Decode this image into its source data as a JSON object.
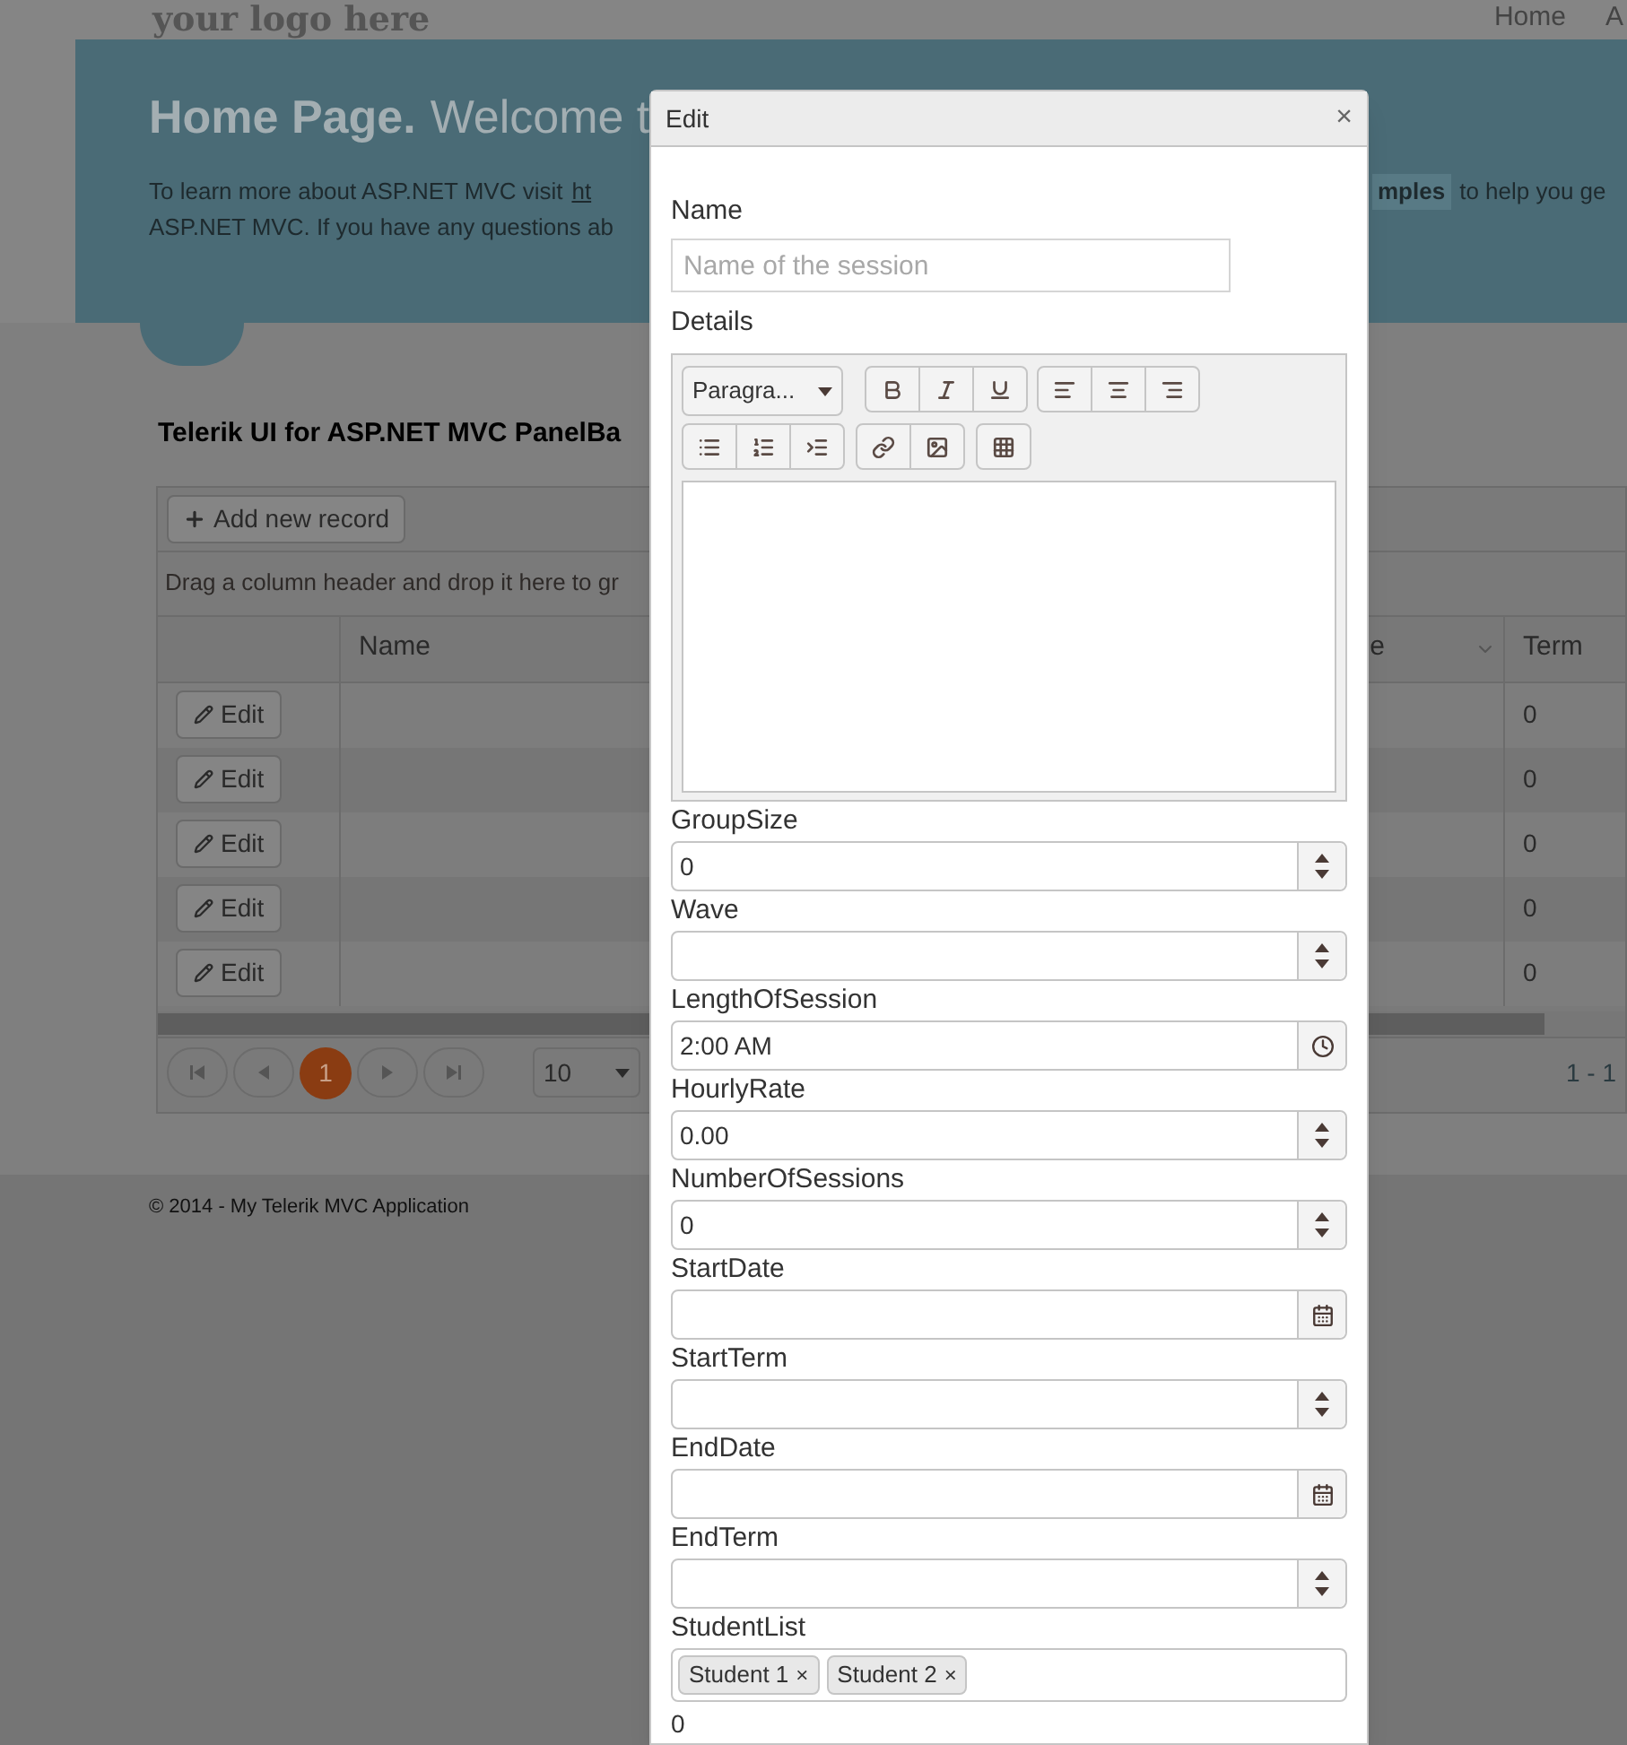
{
  "header": {
    "logo": "your logo here",
    "nav": [
      {
        "label": "Home"
      },
      {
        "label": "A"
      }
    ]
  },
  "jumbotron": {
    "title": "Home Page.",
    "subtitle": "Welcome t",
    "line1_left": "To learn more about ASP.NET MVC visit",
    "line1_link": "ht",
    "line1_highlight": "mples",
    "line1_right": "to help you ge",
    "line2": "ASP.NET MVC. If you have any questions ab"
  },
  "section_title": "Telerik UI for ASP.NET MVC PanelBa",
  "grid": {
    "toolbar_button": "Add new record",
    "group_hint": "Drag a column header and drop it here to gr",
    "columns": [
      {
        "label": "Name"
      },
      {
        "label": "e"
      },
      {
        "label": "Term"
      }
    ],
    "rows": [
      {
        "action": "Edit",
        "term": "0"
      },
      {
        "action": "Edit",
        "term": "0"
      },
      {
        "action": "Edit",
        "term": "0"
      },
      {
        "action": "Edit",
        "term": "0"
      },
      {
        "action": "Edit",
        "term": "0"
      }
    ],
    "pager": {
      "pages": [
        {
          "label": "1",
          "selected": true
        }
      ],
      "page_size": "10",
      "info": "1 - 1"
    }
  },
  "footer": "© 2014 - My Telerik MVC Application",
  "dialog": {
    "title": "Edit",
    "close": "×",
    "name_label": "Name",
    "name_placeholder": "Name of the session",
    "details_label": "Details",
    "format": "Paragra...",
    "fields": [
      {
        "label": "GroupSize",
        "kind": "numeric",
        "value": "0"
      },
      {
        "label": "Wave",
        "kind": "numeric"
      },
      {
        "label": "LengthOfSession",
        "kind": "time",
        "value": "2:00 AM"
      },
      {
        "label": "HourlyRate",
        "kind": "numeric",
        "value": "0.00"
      },
      {
        "label": "NumberOfSessions",
        "kind": "numeric",
        "value": "0"
      },
      {
        "label": "StartDate",
        "kind": "date"
      },
      {
        "label": "StartTerm",
        "kind": "numeric"
      },
      {
        "label": "EndDate",
        "kind": "date"
      },
      {
        "label": "EndTerm",
        "kind": "numeric"
      }
    ],
    "student_label": "StudentList",
    "students": [
      {
        "label": "Student 1",
        "remove": "×"
      },
      {
        "label": "Student 2",
        "remove": "×"
      }
    ],
    "trailing_value": "0"
  }
}
